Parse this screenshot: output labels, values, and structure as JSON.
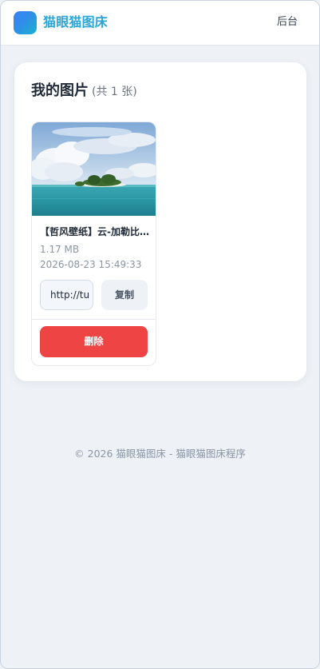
{
  "header": {
    "brand_title": "猫眼猫图床",
    "admin_link": "后台"
  },
  "gallery": {
    "title": "我的图片",
    "count_text": "(共 1 张)",
    "images": [
      {
        "name": "【哲风壁纸】云-加勒比海-天空.png",
        "size": "1.17 MB",
        "uploaded_at": "2026-08-23 15:49:33",
        "url_value": "http://tu",
        "copy_label": "复制",
        "delete_label": "删除"
      }
    ]
  },
  "footer": {
    "text": "© 2026 猫眼猫图床 - 猫眼猫图床程序"
  },
  "colors": {
    "brand": "#2aa5d6",
    "danger": "#ef4444",
    "background": "#eef2f7"
  }
}
